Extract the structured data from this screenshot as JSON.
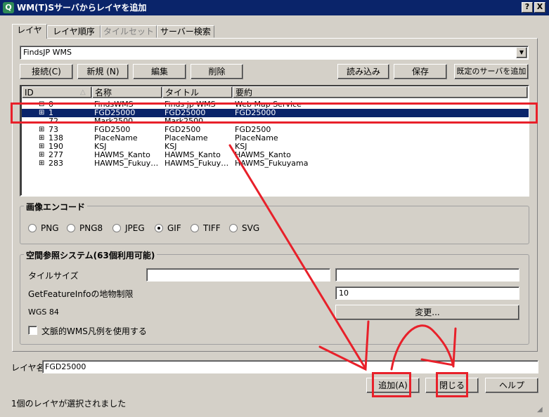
{
  "window": {
    "title": "WM(T)Sサーバからレイヤを追加",
    "help_btn": "?",
    "close_btn": "X"
  },
  "tabs": [
    {
      "label": "レイヤ"
    },
    {
      "label": "レイヤ順序"
    },
    {
      "label": "タイルセット"
    },
    {
      "label": "サーバー検索"
    }
  ],
  "server": {
    "selected": "FindsJP WMS",
    "connect": "接続(C)",
    "new": "新規 (N)",
    "edit": "編集",
    "delete": "削除",
    "load": "読み込み",
    "save": "保存",
    "add_default": "既定のサーバを追加"
  },
  "layer_table": {
    "columns": [
      "ID",
      "名称",
      "タイトル",
      "要約"
    ],
    "rows": [
      {
        "id": "0",
        "name": "FindsWMS",
        "title": "Finds jp WMS",
        "abstract": "Web Map Service",
        "prefix": "⊟",
        "selected": false
      },
      {
        "id": "1",
        "name": "FGD25000",
        "title": "FGD25000",
        "abstract": "FGD25000",
        "prefix": "⊞",
        "selected": true
      },
      {
        "id": "72",
        "name": "Mark2500",
        "title": "Mark2500",
        "abstract": "",
        "prefix": "",
        "selected": false
      },
      {
        "id": "73",
        "name": "FGD2500",
        "title": "FGD2500",
        "abstract": "FGD2500",
        "prefix": "⊞",
        "selected": false
      },
      {
        "id": "138",
        "name": "PlaceName",
        "title": "PlaceName",
        "abstract": "PlaceName",
        "prefix": "⊞",
        "selected": false
      },
      {
        "id": "190",
        "name": "KSJ",
        "title": "KSJ",
        "abstract": "KSJ",
        "prefix": "⊞",
        "selected": false
      },
      {
        "id": "277",
        "name": "HAWMS_Kanto",
        "title": "HAWMS_Kanto",
        "abstract": "HAWMS_Kanto",
        "prefix": "⊞",
        "selected": false
      },
      {
        "id": "283",
        "name": "HAWMS_Fukuy…",
        "title": "HAWMS_Fukuy…",
        "abstract": "HAWMS_Fukuyama",
        "prefix": "⊞",
        "selected": false
      }
    ]
  },
  "image_encoding": {
    "title": "画像エンコード",
    "options": [
      "PNG",
      "PNG8",
      "JPEG",
      "GIF",
      "TIFF",
      "SVG"
    ],
    "selected": "GIF"
  },
  "crs": {
    "title": "空間参照システム(63個利用可能)",
    "tile_size_label": "タイルサイズ",
    "tile_w": "",
    "tile_h": "",
    "feature_limit_label": "GetFeatureInfoの地物制限",
    "feature_limit_value": "10",
    "wgs_label": "WGS 84",
    "change_btn": "変更...",
    "contextual_legend_label": "文脈的WMS凡例を使用する"
  },
  "layer_name": {
    "label": "レイヤ名",
    "value": "FGD25000"
  },
  "bottom": {
    "add": "追加(A)",
    "close": "閉じる",
    "help": "ヘルプ",
    "status": "1個のレイヤが選択されました"
  },
  "colors": {
    "title_bg": "#0a246a",
    "selection_bg": "#0a246a",
    "annotation_red": "#e8202a",
    "face": "#d4d0c8"
  }
}
